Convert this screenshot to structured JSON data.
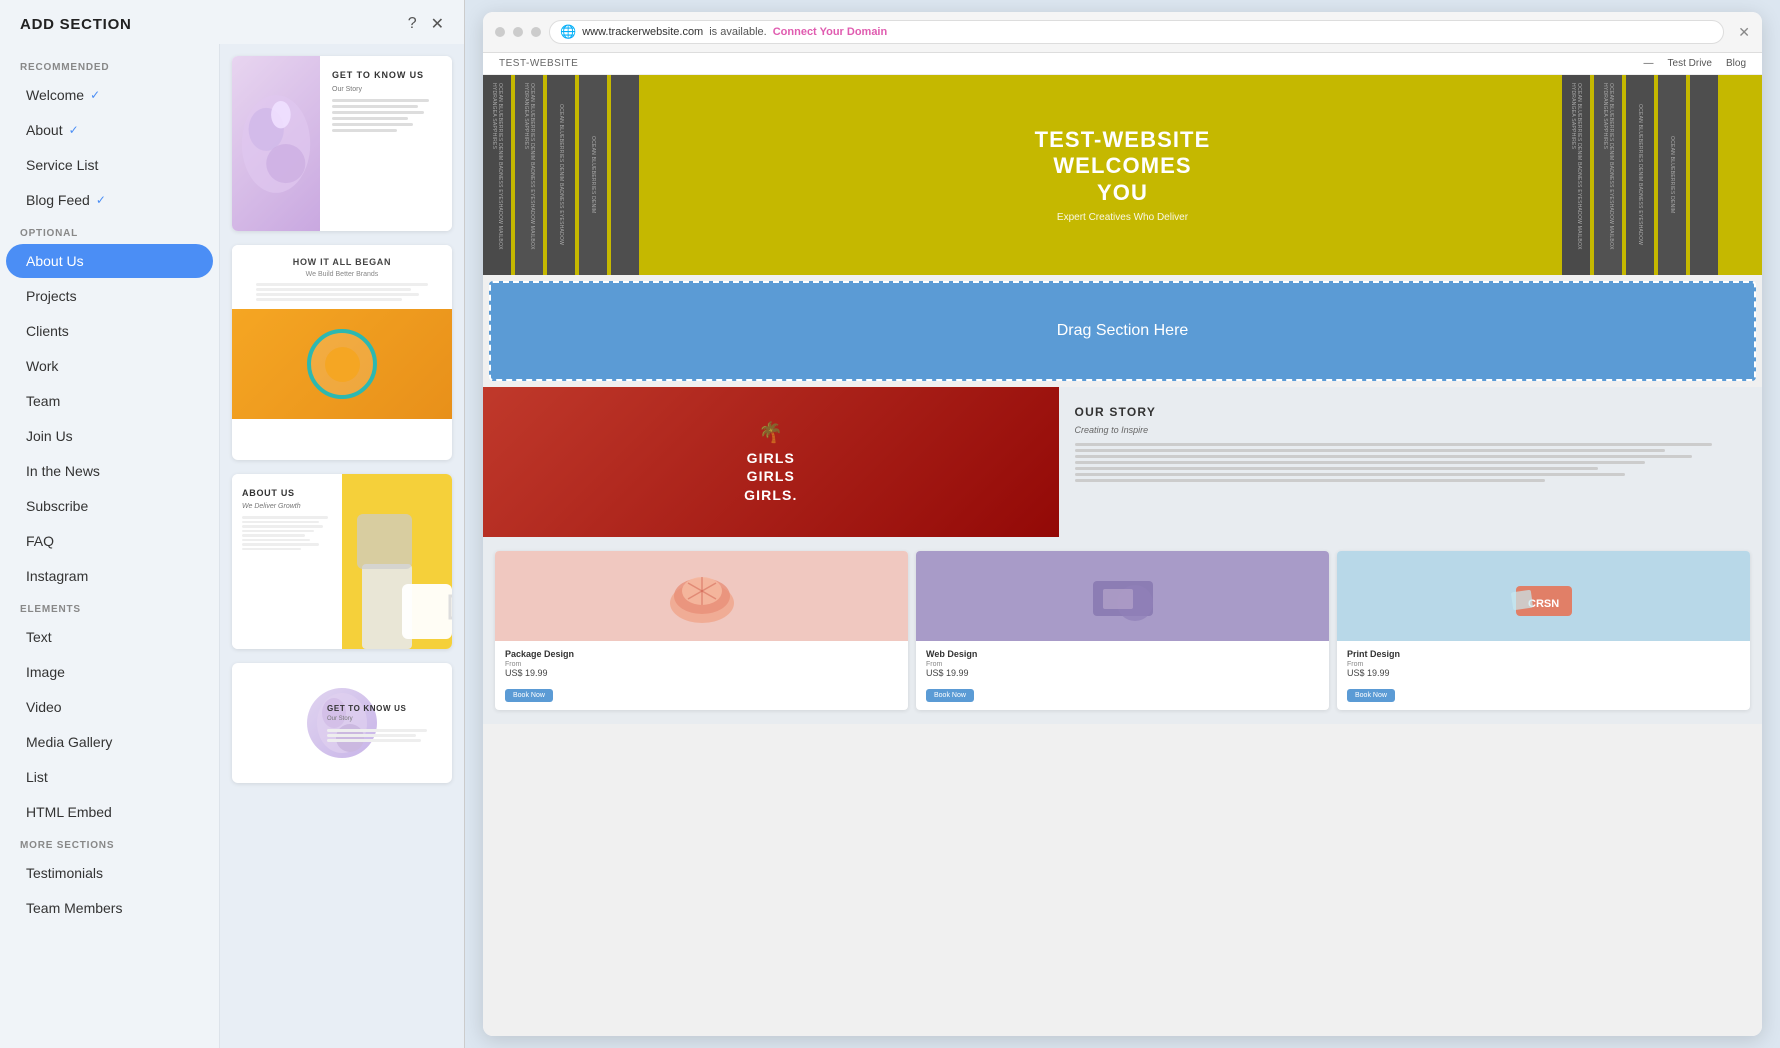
{
  "panel": {
    "title": "ADD SECTION",
    "help_icon": "?",
    "close_icon": "✕"
  },
  "sidebar": {
    "sections": [
      {
        "label": "RECOMMENDED",
        "items": [
          {
            "id": "welcome",
            "label": "Welcome",
            "check": "✓",
            "active": false
          },
          {
            "id": "about",
            "label": "About",
            "check": "✓",
            "active": false
          },
          {
            "id": "service-list",
            "label": "Service List",
            "check": "",
            "active": false
          },
          {
            "id": "blog-feed",
            "label": "Blog Feed",
            "check": "✓",
            "active": false
          }
        ]
      },
      {
        "label": "OPTIONAL",
        "items": [
          {
            "id": "about-us",
            "label": "About Us",
            "check": "",
            "active": true
          },
          {
            "id": "projects",
            "label": "Projects",
            "check": "",
            "active": false
          },
          {
            "id": "clients",
            "label": "Clients",
            "check": "",
            "active": false
          },
          {
            "id": "work",
            "label": "Work",
            "check": "",
            "active": false
          },
          {
            "id": "team",
            "label": "Team",
            "check": "",
            "active": false
          },
          {
            "id": "join-us",
            "label": "Join Us",
            "check": "",
            "active": false
          },
          {
            "id": "in-the-news",
            "label": "In the News",
            "check": "",
            "active": false
          },
          {
            "id": "subscribe",
            "label": "Subscribe",
            "check": "",
            "active": false
          },
          {
            "id": "faq",
            "label": "FAQ",
            "check": "",
            "active": false
          },
          {
            "id": "instagram",
            "label": "Instagram",
            "check": "",
            "active": false
          }
        ]
      },
      {
        "label": "ELEMENTS",
        "items": [
          {
            "id": "text",
            "label": "Text",
            "check": "",
            "active": false
          },
          {
            "id": "image",
            "label": "Image",
            "check": "",
            "active": false
          },
          {
            "id": "video",
            "label": "Video",
            "check": "",
            "active": false
          },
          {
            "id": "media-gallery",
            "label": "Media Gallery",
            "check": "",
            "active": false
          },
          {
            "id": "list",
            "label": "List",
            "check": "",
            "active": false
          },
          {
            "id": "html-embed",
            "label": "HTML Embed",
            "check": "",
            "active": false
          }
        ]
      },
      {
        "label": "MORE SECTIONS",
        "items": [
          {
            "id": "testimonials",
            "label": "Testimonials",
            "check": "",
            "active": false
          },
          {
            "id": "team-members",
            "label": "Team Members",
            "check": "",
            "active": false
          }
        ]
      }
    ]
  },
  "cards": [
    {
      "id": "card1",
      "title": "GET TO KNOW US",
      "subtitle": "Our Story"
    },
    {
      "id": "card2",
      "title": "HOW IT ALL BEGAN",
      "subtitle": "We Build Better Brands"
    },
    {
      "id": "card3",
      "title": "ABOUT US",
      "subtitle": "We Deliver Growth"
    },
    {
      "id": "card4",
      "title": "GET TO KNOW US",
      "subtitle": "Our Story"
    }
  ],
  "browser": {
    "url": "www.trackerwebsite.com",
    "url_status": "is available.",
    "connect_label": "Connect Your Domain",
    "site_name": "TEST-WEBSITE",
    "nav_links": [
      "— ",
      "Test Drive",
      "Blog"
    ],
    "hero_title": "TEST-WEBSITE\nWELCOMES\nYOU",
    "hero_subtitle": "Expert Creatives Who Deliver",
    "drag_label": "Drag Section Here",
    "story_heading": "OUR STORY",
    "story_tag": "Creating to Inspire",
    "girls_text": "GIRLS\nGIRLS\nGIRLS.",
    "portfolio_cards": [
      {
        "title": "Package Design",
        "price_label": "From",
        "price": "US$ 19.99",
        "btn_label": "Book Now"
      },
      {
        "title": "Web Design",
        "price_label": "From",
        "price": "US$ 19.99",
        "btn_label": "Book Now"
      },
      {
        "title": "Print Design",
        "price_label": "From",
        "price": "US$ 19.99",
        "btn_label": "Book Now"
      }
    ]
  },
  "books_left": [
    "OCEAN BLUEBERRIES DENIM BADNESS EYESHADOW MAILBOX HYDRANGEA SAPPHIRES",
    "OCEAN BLUEBERRIES DENIM BADNESS EYESHADOW MAILBOX HYDRANGEA SAPPHIRES",
    "OCEAN BLUEBERRIES DENIM BADNESS EYESHADOW",
    "OCEAN BLUEBERRIES DENIM"
  ]
}
